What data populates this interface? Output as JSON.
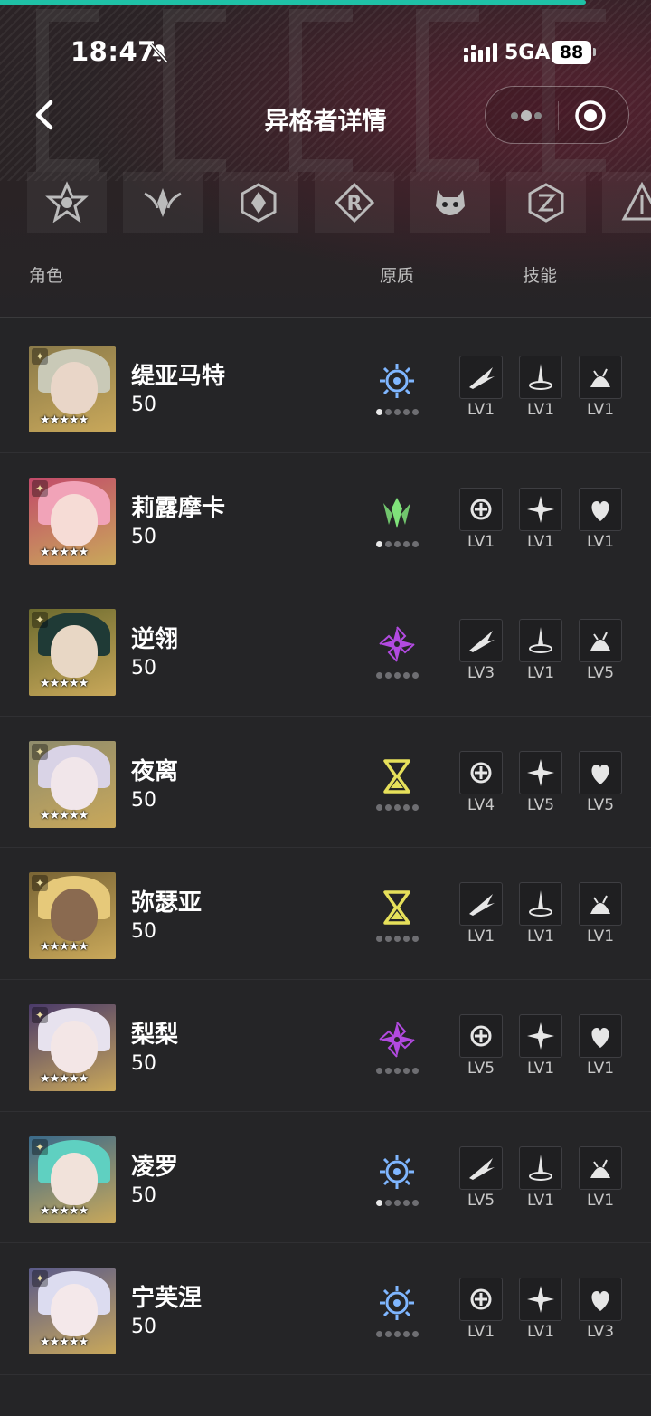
{
  "progress": {
    "value": 0.9
  },
  "statusbar": {
    "time": "18:47",
    "network": "5GA",
    "battery": "88",
    "icons": [
      "bell-muted-icon",
      "signal-icon"
    ]
  },
  "nav": {
    "title": "异格者详情",
    "back_icon": "chevron-left-icon",
    "more_icon": "more-dots-icon",
    "close_icon": "target-circle-icon"
  },
  "factions": [
    "faction-star-emblem",
    "faction-winged-emblem",
    "faction-shield-emblem",
    "faction-r-emblem",
    "faction-beast-emblem",
    "faction-hex-emblem",
    "faction-triangle-emblem"
  ],
  "columns": {
    "role": "角色",
    "quality": "原质",
    "skill": "技能"
  },
  "colors": {
    "accent": "#1fc1a6",
    "blue_element": "#7fb6ff",
    "green_element": "#7fe27a",
    "purple_element": "#b24ae0",
    "yellow_element": "#e6e05a"
  },
  "characters": [
    {
      "name": "缇亚马特",
      "level": "50",
      "element": "blue",
      "dots_on": 1,
      "skills": [
        "LV1",
        "LV1",
        "LV1"
      ]
    },
    {
      "name": "莉露摩卡",
      "level": "50",
      "element": "green",
      "dots_on": 1,
      "skills": [
        "LV1",
        "LV1",
        "LV1"
      ]
    },
    {
      "name": "逆翎",
      "level": "50",
      "element": "purple",
      "dots_on": 0,
      "skills": [
        "LV3",
        "LV1",
        "LV5"
      ]
    },
    {
      "name": "夜离",
      "level": "50",
      "element": "yellow",
      "dots_on": 0,
      "skills": [
        "LV4",
        "LV5",
        "LV5"
      ]
    },
    {
      "name": "弥瑟亚",
      "level": "50",
      "element": "yellow",
      "dots_on": 0,
      "skills": [
        "LV1",
        "LV1",
        "LV1"
      ]
    },
    {
      "name": "梨梨",
      "level": "50",
      "element": "purple",
      "dots_on": 0,
      "skills": [
        "LV5",
        "LV1",
        "LV1"
      ]
    },
    {
      "name": "凌罗",
      "level": "50",
      "element": "blue",
      "dots_on": 1,
      "skills": [
        "LV5",
        "LV1",
        "LV1"
      ]
    },
    {
      "name": "宁芙涅",
      "level": "50",
      "element": "blue",
      "dots_on": 0,
      "skills": [
        "LV1",
        "LV1",
        "LV3"
      ]
    }
  ]
}
